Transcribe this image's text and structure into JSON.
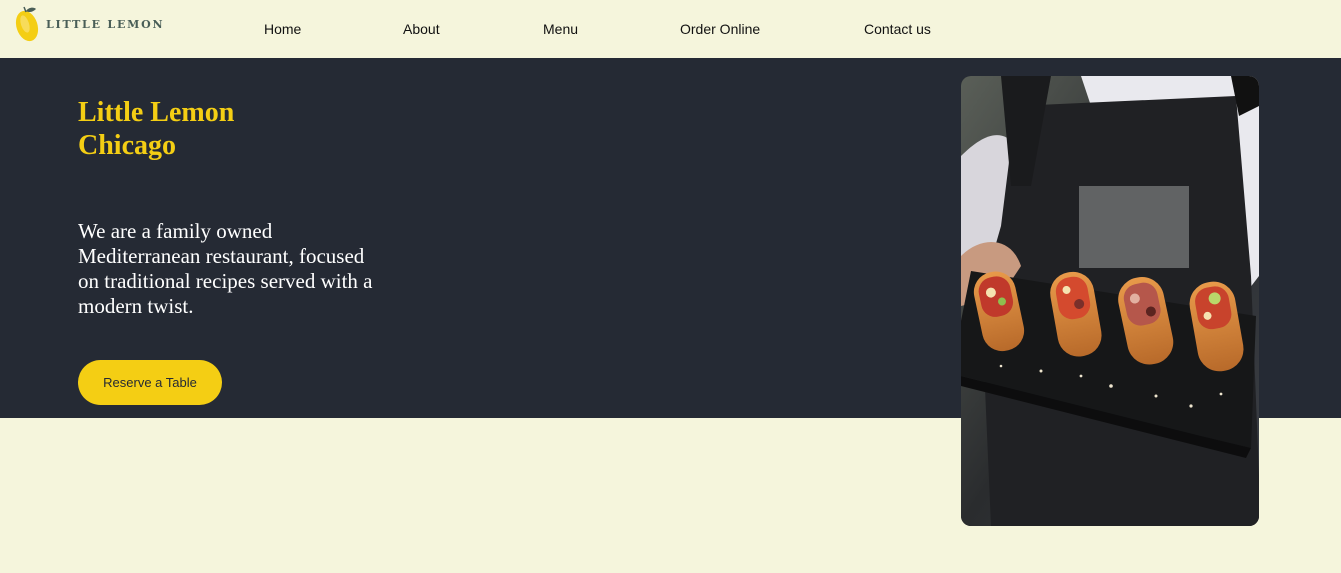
{
  "brand": {
    "name": "LITTLE LEMON"
  },
  "nav": {
    "items": [
      {
        "label": "Home"
      },
      {
        "label": "About"
      },
      {
        "label": "Menu"
      },
      {
        "label": "Order Online"
      },
      {
        "label": "Contact us"
      }
    ]
  },
  "hero": {
    "title_line1": "Little Lemon",
    "title_line2": "Chicago",
    "description": "We are a family owned Mediterranean restaurant, focused on traditional recipes served with a modern twist.",
    "reserve_label": "Reserve a Table"
  },
  "colors": {
    "primary_dark": "#252a34",
    "accent_yellow": "#f4ce14",
    "page_background": "#f5f5dc",
    "brand_green": "#495e57"
  },
  "icons": {
    "logo": "lemon-icon"
  }
}
